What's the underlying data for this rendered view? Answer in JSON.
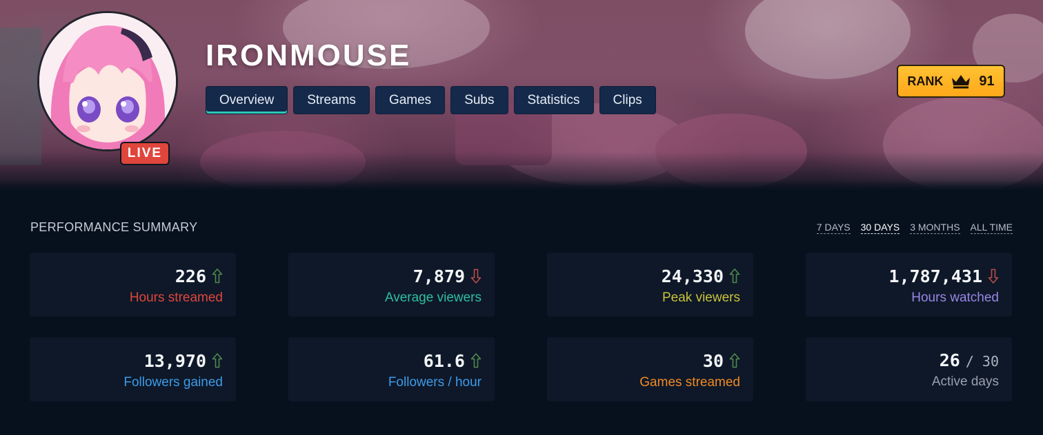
{
  "channel": {
    "name": "IRONMOUSE",
    "live_label": "LIVE"
  },
  "tabs": [
    {
      "label": "Overview",
      "active": true
    },
    {
      "label": "Streams",
      "active": false
    },
    {
      "label": "Games",
      "active": false
    },
    {
      "label": "Subs",
      "active": false
    },
    {
      "label": "Statistics",
      "active": false
    },
    {
      "label": "Clips",
      "active": false
    }
  ],
  "rank": {
    "label": "RANK",
    "icon": "crown-icon",
    "value": "91"
  },
  "summary": {
    "title": "PERFORMANCE SUMMARY",
    "periods": [
      {
        "label": "7 DAYS",
        "active": false
      },
      {
        "label": "30 DAYS",
        "active": true
      },
      {
        "label": "3 MONTHS",
        "active": false
      },
      {
        "label": "ALL TIME",
        "active": false
      }
    ],
    "stats": [
      {
        "value": "226",
        "label": "Hours streamed",
        "trend": "up",
        "label_color": "#e0463c"
      },
      {
        "value": "7,879",
        "label": "Average viewers",
        "trend": "down",
        "label_color": "#2fbf9e"
      },
      {
        "value": "24,330",
        "label": "Peak viewers",
        "trend": "up",
        "label_color": "#c9c23a"
      },
      {
        "value": "1,787,431",
        "label": "Hours watched",
        "trend": "down",
        "label_color": "#9a86e6"
      },
      {
        "value": "13,970",
        "label": "Followers gained",
        "trend": "up",
        "label_color": "#3d9be9"
      },
      {
        "value": "61.6",
        "label": "Followers / hour",
        "trend": "up",
        "label_color": "#3d9be9"
      },
      {
        "value": "30",
        "label": "Games streamed",
        "trend": "up",
        "label_color": "#f08a24"
      },
      {
        "value": "26",
        "value_sub": "/ 30",
        "label": "Active days",
        "trend": "none",
        "label_color": "#9aa1ad"
      }
    ]
  },
  "colors": {
    "trend_up": "#4f8a4f",
    "trend_down": "#b94c4c",
    "tab_bg": "#15294a",
    "tab_active_underline": "#2ec7b5",
    "rank_bg": "#ffb21f",
    "live_bg": "#e0463c"
  }
}
